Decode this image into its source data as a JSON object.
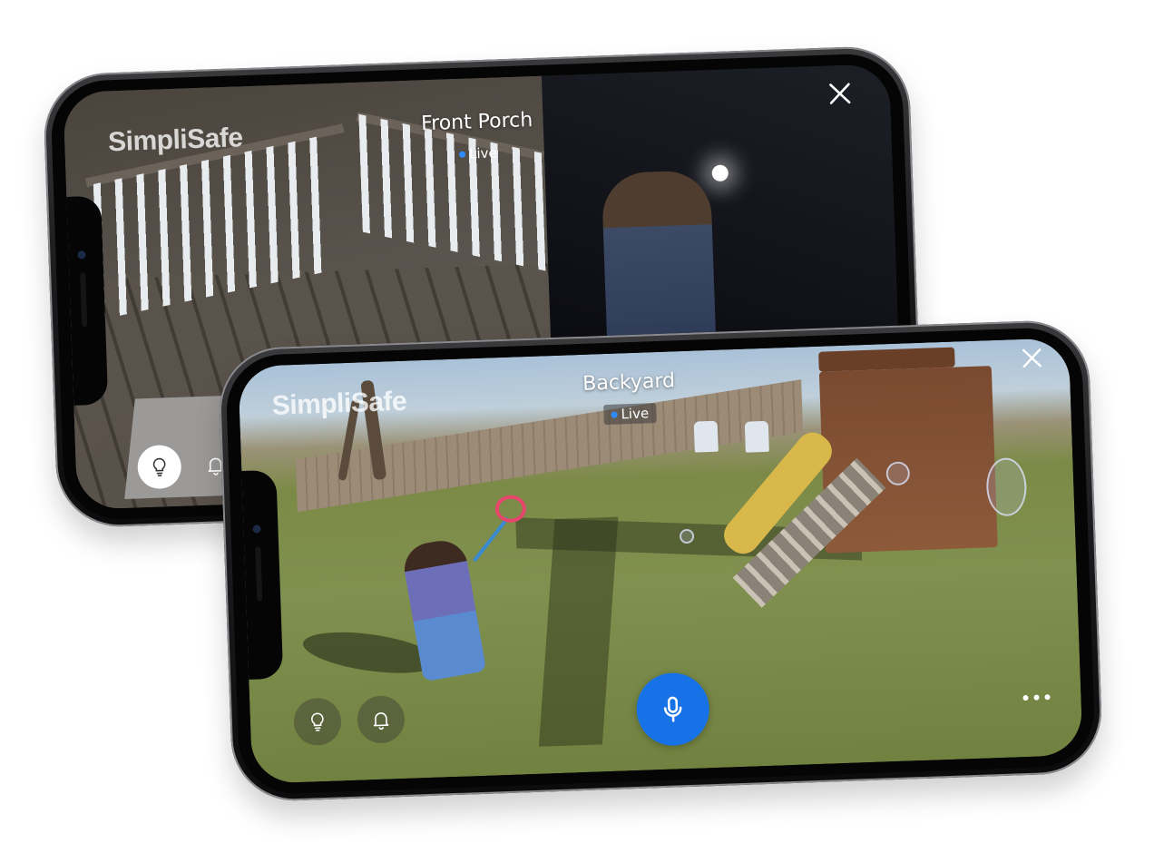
{
  "front_phone": {
    "brand": "SimpliSafe",
    "camera_name": "Front Porch",
    "status": "Live",
    "status_color": "#2d8cff",
    "buttons": {
      "light": "lightbulb-icon",
      "chime": "bell-icon",
      "close": "close-icon"
    }
  },
  "back_phone": {
    "brand": "SimpliSafe",
    "camera_name": "Backyard",
    "status": "Live",
    "status_color": "#2d8cff",
    "mic_color": "#1672e6",
    "buttons": {
      "light": "lightbulb-icon",
      "chime": "bell-icon",
      "talk": "microphone-icon",
      "more": "more-dots-icon",
      "close": "close-icon"
    }
  }
}
